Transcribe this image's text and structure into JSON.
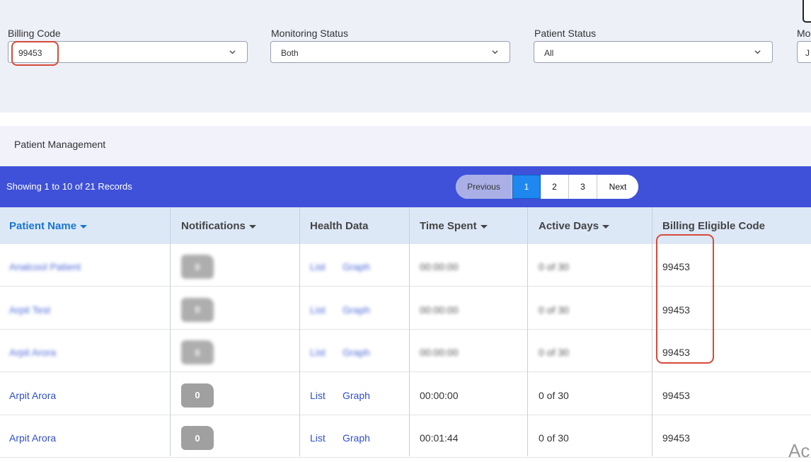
{
  "filters": {
    "billing_code": {
      "label": "Billing Code",
      "value": "99453"
    },
    "monitoring_status": {
      "label": "Monitoring Status",
      "value": "Both"
    },
    "patient_status": {
      "label": "Patient Status",
      "value": "All"
    },
    "month": {
      "label": "Mo",
      "value": "J"
    }
  },
  "section": {
    "title": "Patient Management"
  },
  "records": {
    "summary": "Showing 1 to 10 of 21 Records",
    "pagination": {
      "previous": "Previous",
      "pages": [
        "1",
        "2",
        "3"
      ],
      "active": "1",
      "next": "Next"
    }
  },
  "table": {
    "headers": [
      "Patient Name",
      "Notifications",
      "Health Data",
      "Time Spent",
      "Active Days",
      "Billing Eligible Code"
    ],
    "rows": [
      {
        "name": "Analcool Patient",
        "notifications": "0",
        "list": "List",
        "graph": "Graph",
        "time": "00:00:00",
        "days": "0 of 30",
        "code": "99453",
        "blurred": true
      },
      {
        "name": "Arpit Test",
        "notifications": "0",
        "list": "List",
        "graph": "Graph",
        "time": "00:00:00",
        "days": "0 of 30",
        "code": "99453",
        "blurred": true
      },
      {
        "name": "Arpit Arora",
        "notifications": "0",
        "list": "List",
        "graph": "Graph",
        "time": "00:00:00",
        "days": "0 of 30",
        "code": "99453",
        "blurred": true
      },
      {
        "name": "Arpit Arora",
        "notifications": "0",
        "list": "List",
        "graph": "Graph",
        "time": "00:00:00",
        "days": "0 of 30",
        "code": "99453",
        "blurred": false
      },
      {
        "name": "Arpit Arora",
        "notifications": "0",
        "list": "List",
        "graph": "Graph",
        "time": "00:01:44",
        "days": "0 of 30",
        "code": "99453",
        "blurred": false
      }
    ]
  },
  "watermark": "Ac",
  "colors": {
    "header_bar": "#3f51d8",
    "highlight": "#d64a3a",
    "link": "#2f4fd0",
    "active_page": "#1e88f0"
  }
}
